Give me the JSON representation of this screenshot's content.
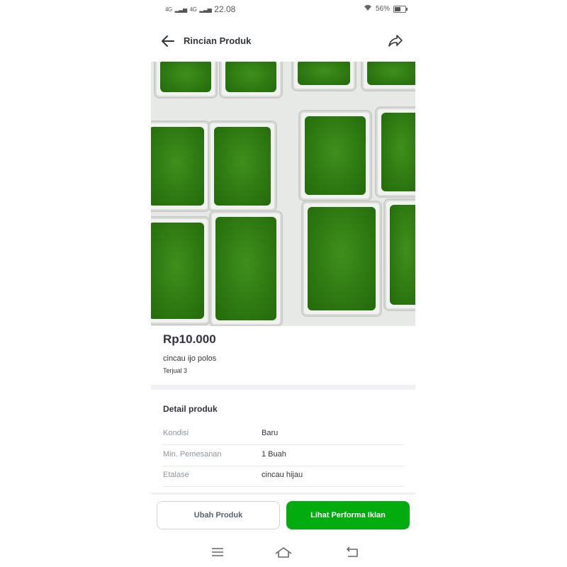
{
  "status": {
    "signal1": "4G",
    "signal2": "4G",
    "time": "22.08",
    "battery": "56%",
    "battery_level": 0.56
  },
  "header": {
    "title": "Rincian Produk",
    "back_icon": "arrow-left-icon",
    "share_icon": "share-icon"
  },
  "product": {
    "image_icon": "product-photo",
    "price": "Rp10.000",
    "name": "cincau ijo polos",
    "sold": "Terjual 3"
  },
  "details": {
    "title": "Detail produk",
    "rows": [
      {
        "label": "Kondisi",
        "value": "Baru"
      },
      {
        "label": "Min. Pemesanan",
        "value": "1 Buah"
      },
      {
        "label": "Etalase",
        "value": "cincau hijau"
      }
    ]
  },
  "actions": {
    "edit_label": "Ubah Produk",
    "ads_label": "Lihat Performa Iklan"
  },
  "colors": {
    "accent": "#03ac0e",
    "text": "#31353b",
    "muted": "#8d96a2"
  }
}
